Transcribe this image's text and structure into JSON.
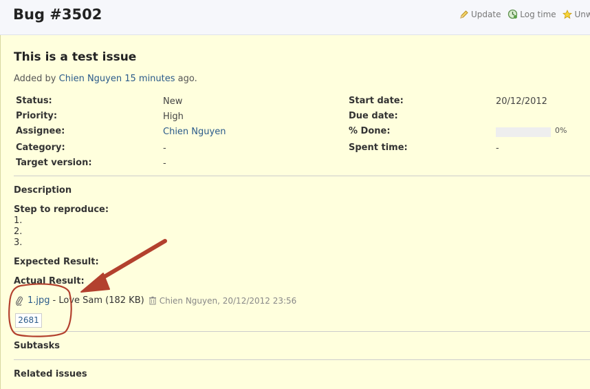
{
  "header": {
    "title": "Bug #3502",
    "actions": [
      {
        "label": "Update",
        "icon": "pencil-icon"
      },
      {
        "label": "Log time",
        "icon": "clock-icon"
      },
      {
        "label": "Unwatch",
        "icon": "star-icon"
      }
    ]
  },
  "issue": {
    "subject": "This is a test issue",
    "added_by_prefix": "Added by",
    "author": "Chien Nguyen",
    "age": "15 minutes",
    "added_by_suffix": "ago."
  },
  "attributes": {
    "left": [
      {
        "label": "Status:",
        "value": "New"
      },
      {
        "label": "Priority:",
        "value": "High"
      },
      {
        "label": "Assignee:",
        "value": "Chien Nguyen"
      },
      {
        "label": "Category:",
        "value": "-"
      },
      {
        "label": "Target version:",
        "value": "-"
      }
    ],
    "right": [
      {
        "label": "Start date:",
        "value": "20/12/2012"
      },
      {
        "label": "Due date:",
        "value": ""
      },
      {
        "label": "% Done:",
        "value": "0%"
      },
      {
        "label": "Spent time:",
        "value": "-"
      }
    ],
    "done_ratio": 0
  },
  "description": {
    "heading": "Description",
    "step_heading": "Step to reproduce:",
    "steps": [
      "1.",
      "2.",
      "3."
    ],
    "expected_heading": "Expected Result:",
    "actual_heading": "Actual Result:"
  },
  "attachment": {
    "filename": "1.jpg",
    "description": "- Love Sam (182 KB)",
    "meta": "Chien Nguyen, 20/12/2012 23:56",
    "thumbnail_label": "2681"
  },
  "sections": {
    "subtasks": "Subtasks",
    "related": "Related issues"
  },
  "colors": {
    "issue_background": "#ffffdd",
    "link": "#2a5a8a",
    "annotation": "#b3412e"
  }
}
